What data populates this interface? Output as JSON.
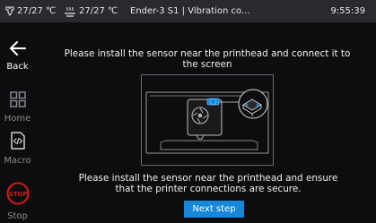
{
  "status_bar": {
    "nozzle_icon": "nozzle-icon",
    "nozzle_temp": "27/27 ℃",
    "bed_icon": "heated-bed-icon",
    "bed_temp": "27/27 ℃",
    "title": "Ender-3 S1 | Vibration co...",
    "time": "9:55:39"
  },
  "sidebar": {
    "items": [
      {
        "label": "Back",
        "icon": "back-arrow-icon"
      },
      {
        "label": "Home",
        "icon": "home-grid-icon"
      },
      {
        "label": "Macro",
        "icon": "macro-code-icon"
      },
      {
        "label": "Stop",
        "icon": "stop-icon"
      }
    ]
  },
  "main": {
    "instruction_top": "Please install the sensor near the printhead and connect it to the screen",
    "illustration_icon": "sensor-printhead-illustration",
    "instruction_bottom": "Please install the sensor near the printhead and ensure that the printer connections are secure.",
    "next_label": "Next step"
  },
  "colors": {
    "accent": "#1687d9",
    "stop": "#d11a1a",
    "status_bar_bg": "#2a2a2e",
    "background": "#0d0d0f"
  }
}
